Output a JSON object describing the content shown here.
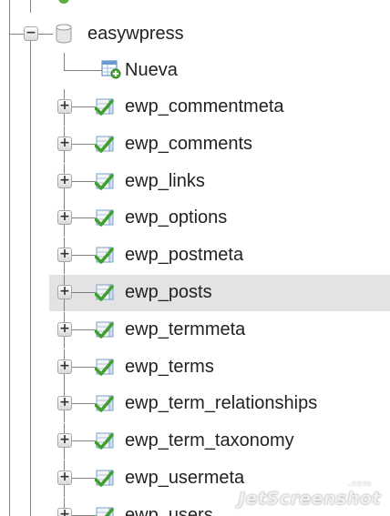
{
  "database": {
    "name": "easywpress",
    "new_label": "Nueva",
    "expanded_symbol": "−"
  },
  "tables": [
    {
      "name": "ewp_commentmeta",
      "toggle": "+"
    },
    {
      "name": "ewp_comments",
      "toggle": "+"
    },
    {
      "name": "ewp_links",
      "toggle": "+"
    },
    {
      "name": "ewp_options",
      "toggle": "+"
    },
    {
      "name": "ewp_postmeta",
      "toggle": "+"
    },
    {
      "name": "ewp_posts",
      "toggle": "+"
    },
    {
      "name": "ewp_termmeta",
      "toggle": "+"
    },
    {
      "name": "ewp_terms",
      "toggle": "+"
    },
    {
      "name": "ewp_term_relationships",
      "toggle": "+"
    },
    {
      "name": "ewp_term_taxonomy",
      "toggle": "+"
    },
    {
      "name": "ewp_usermeta",
      "toggle": "+"
    },
    {
      "name": "ewp_users",
      "toggle": "+"
    }
  ],
  "highlighted_table": "ewp_posts",
  "watermark": {
    "text": "JetScreenshot",
    "suffix": ".com"
  },
  "colors": {
    "link": "#235a81",
    "highlight": "#e3e3e3",
    "tree_line": "#808080"
  }
}
